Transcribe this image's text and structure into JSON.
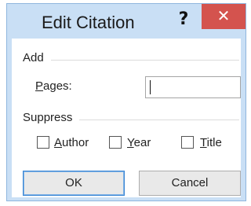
{
  "dialog": {
    "title": "Edit Citation",
    "help_glyph": "?",
    "close_glyph": "✕"
  },
  "add": {
    "section_label": "Add",
    "pages_label_accel": "P",
    "pages_label_rest": "ages:",
    "pages_value": ""
  },
  "suppress": {
    "section_label": "Suppress",
    "author": {
      "accel": "A",
      "rest": "uthor",
      "checked": false
    },
    "year": {
      "accel": "Y",
      "rest": "ear",
      "checked": false
    },
    "title": {
      "accel": "T",
      "rest": "itle",
      "checked": false
    }
  },
  "buttons": {
    "ok_label": "OK",
    "cancel_label": "Cancel"
  },
  "colors": {
    "frame": "#c9dff5",
    "close": "#d4534e",
    "ok_border": "#3b86d4"
  }
}
